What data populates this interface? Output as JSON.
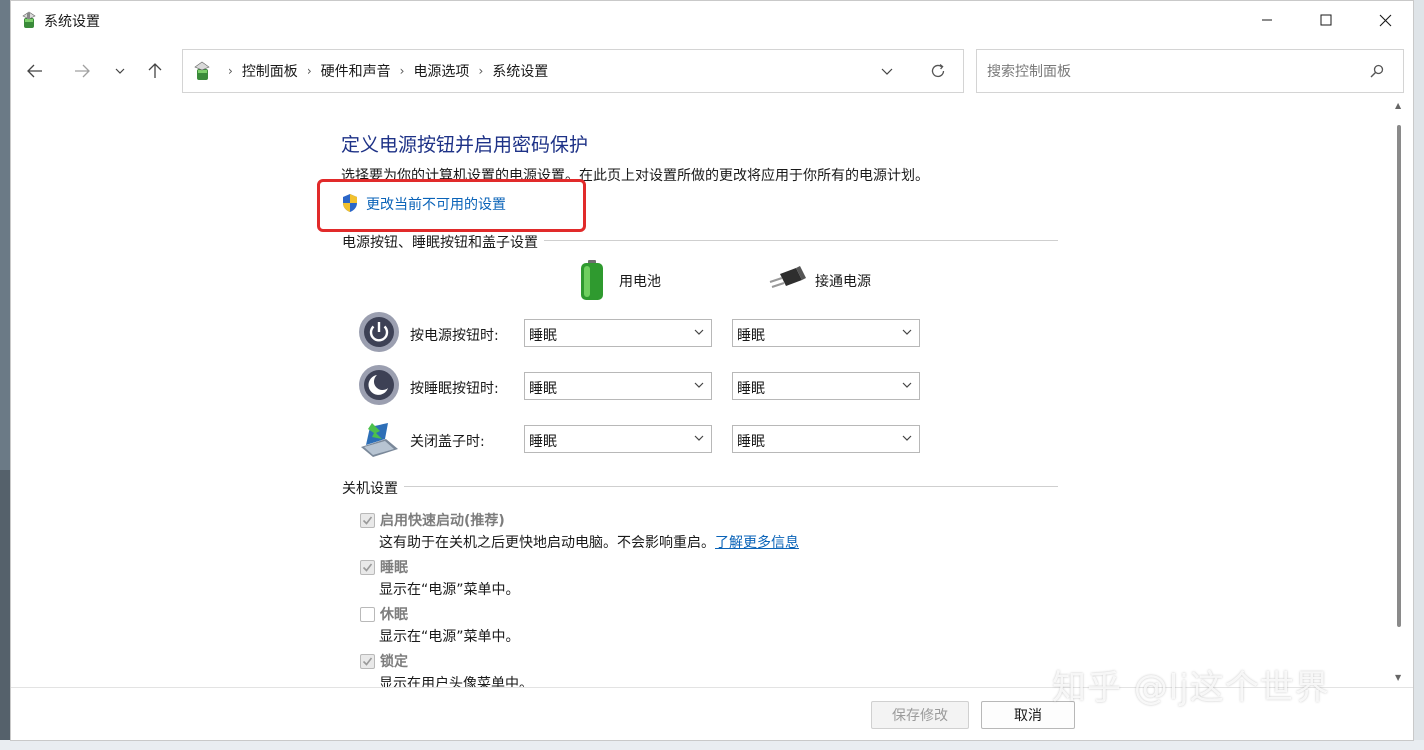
{
  "window": {
    "title": "系统设置"
  },
  "nav": {
    "breadcrumb": [
      "控制面板",
      "硬件和声音",
      "电源选项",
      "系统设置"
    ],
    "search_placeholder": "搜索控制面板"
  },
  "page": {
    "title": "定义电源按钮并启用密码保护",
    "description": "选择要为你的计算机设置的电源设置。在此页上对设置所做的更改将应用于你所有的电源计划。",
    "change_link": "更改当前不可用的设置"
  },
  "power_section": {
    "heading": "电源按钮、睡眠按钮和盖子设置",
    "col_battery": "用电池",
    "col_plugged": "接通电源",
    "rows": [
      {
        "label": "按电源按钮时:",
        "battery": "睡眠",
        "plugged": "睡眠"
      },
      {
        "label": "按睡眠按钮时:",
        "battery": "睡眠",
        "plugged": "睡眠"
      },
      {
        "label": "关闭盖子时:",
        "battery": "睡眠",
        "plugged": "睡眠"
      }
    ]
  },
  "shutdown_section": {
    "heading": "关机设置",
    "items": [
      {
        "label": "启用快速启动(推荐)",
        "checked": true,
        "desc": "这有助于在关机之后更快地启动电脑。不会影响重启。",
        "link": "了解更多信息"
      },
      {
        "label": "睡眠",
        "checked": true,
        "desc": "显示在“电源”菜单中。"
      },
      {
        "label": "休眠",
        "checked": false,
        "desc": "显示在“电源”菜单中。"
      },
      {
        "label": "锁定",
        "checked": true,
        "desc": "显示在用户头像菜单中。"
      }
    ]
  },
  "footer": {
    "save_label": "保存修改",
    "cancel_label": "取消"
  },
  "watermark": "知乎 @lj这个世界",
  "colors": {
    "title_blue": "#1e3287",
    "link_blue": "#0a63b8",
    "highlight_red": "#e12a2a"
  }
}
